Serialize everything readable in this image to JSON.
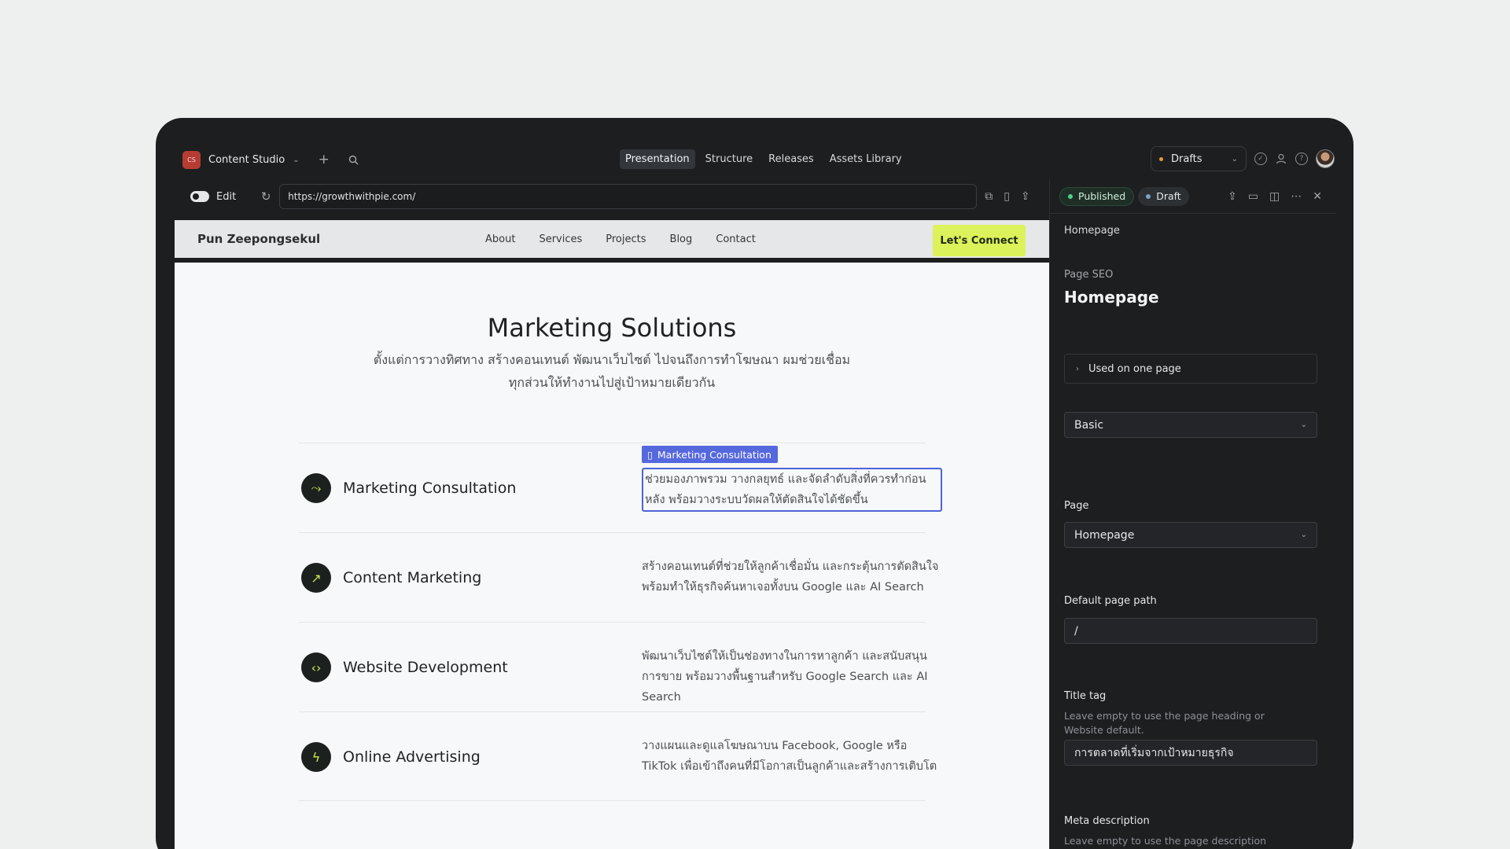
{
  "workspace": {
    "badge": "CS",
    "name": "Content Studio"
  },
  "nav_tabs": [
    {
      "label": "Presentation"
    },
    {
      "label": "Structure"
    },
    {
      "label": "Releases"
    },
    {
      "label": "Assets Library"
    }
  ],
  "perspective": {
    "label": "Drafts"
  },
  "toolbar": {
    "edit_label": "Edit",
    "url": "https://growthwithpie.com/"
  },
  "site": {
    "brand": "Pun Zeepongsekul",
    "menu": [
      "About",
      "Services",
      "Projects",
      "Blog",
      "Contact"
    ],
    "cta": "Let's Connect",
    "hero_title": "Marketing Solutions",
    "hero_subtitle": "ตั้งแต่การวางทิศทาง สร้างคอนเทนต์ พัฒนาเว็บไซต์ ไปจนถึงการทำโฆษณา ผมช่วยเชื่อมทุกส่วนให้ทำงานไปสู่เป้าหมายเดียวกัน",
    "services": [
      {
        "title": "Marketing Consultation",
        "icon": "route-icon",
        "glyph": "⤳",
        "desc": "ช่วยมองภาพรวม วางกลยุทธ์ และจัดลำดับสิ่งที่ควรทำก่อนหลัง พร้อมวางระบบวัดผลให้ตัดสินใจได้ชัดขึ้น",
        "selected": true
      },
      {
        "title": "Content Marketing",
        "icon": "trend-icon",
        "glyph": "↗",
        "desc": "สร้างคอนเทนต์ที่ช่วยให้ลูกค้าเชื่อมั่น และกระตุ้นการตัดสินใจ พร้อมทำให้ธุรกิจค้นหาเจอทั้งบน Google และ AI Search",
        "selected": false
      },
      {
        "title": "Website Development",
        "icon": "code-icon",
        "glyph": "‹›",
        "desc": "พัฒนาเว็บไซต์ให้เป็นช่องทางในการหาลูกค้า และสนับสนุนการขาย พร้อมวางพื้นฐานสำหรับ Google Search และ AI Search",
        "selected": false
      },
      {
        "title": "Online Advertising",
        "icon": "bolt-icon",
        "glyph": "ϟ",
        "desc": "วางแผนและดูแลโฆษณาบน Facebook, Google หรือ TikTok เพื่อเข้าถึงคนที่มีโอกาสเป็นลูกค้าและสร้างการเติบโต",
        "selected": false
      }
    ],
    "selection_tag": "Marketing Consultation"
  },
  "panel": {
    "status_published": "Published",
    "status_draft": "Draft",
    "breadcrumb": "Homepage",
    "section_label": "Page SEO",
    "section_title": "Homepage",
    "used_on": "Used on one page",
    "variant_select": "Basic",
    "page_label": "Page",
    "page_select": "Homepage",
    "path_label": "Default page path",
    "path_value": "/",
    "title_label": "Title tag",
    "title_help": "Leave empty to use the page heading or Website default.",
    "title_value": "การตลาดที่เริ่มจากเป้าหมายธุรกิจ",
    "meta_label": "Meta description",
    "meta_help": "Leave empty to use the page description or Website default."
  },
  "colors": {
    "accent_cta": "#dcf25a",
    "selection": "#5668de",
    "published": "#4ed08a",
    "draft_dot": "#e39a3a"
  }
}
